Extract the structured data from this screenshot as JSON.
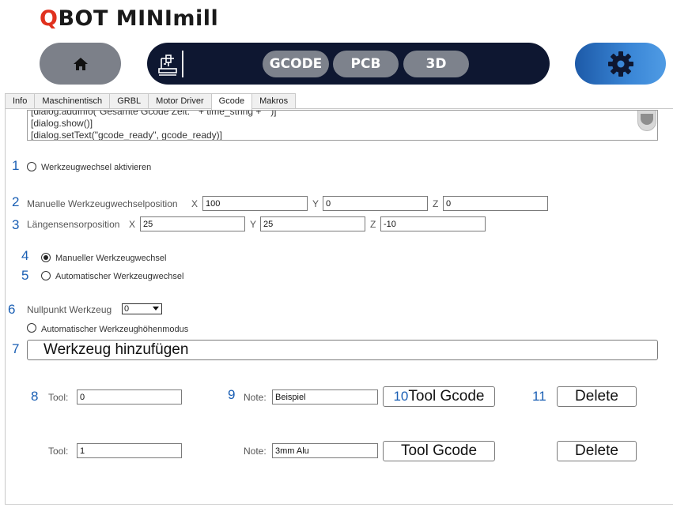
{
  "logo": {
    "q": "Q",
    "rest": "BOT MINImill"
  },
  "nav": {
    "home_icon": "home-icon",
    "machine_icon": "machine-icon",
    "pills": [
      "GCODE",
      "PCB",
      "3D"
    ],
    "settings_icon": "gear-icon"
  },
  "tabs": [
    "Info",
    "Maschinentisch",
    "GRBL",
    "Motor Driver",
    "Gcode",
    "Makros"
  ],
  "active_tab": "Gcode",
  "code": {
    "lines": [
      "[dialog.addInfo(\"Gesamte Gcode Zeit: \" + time_string + \"\")]",
      "[dialog.show()]",
      "[dialog.setText(\"gcode_ready\", gcode_ready)]"
    ]
  },
  "annotations": [
    "1",
    "2",
    "3",
    "4",
    "5",
    "6",
    "7",
    "8",
    "9",
    "10",
    "11"
  ],
  "toolchange": {
    "enable_label": "Werkzeugwechsel aktivieren",
    "manual_pos_label": "Manuelle Werkzeugwechselposition",
    "manual_pos": {
      "x": "100",
      "y": "0",
      "z": "0"
    },
    "sensor_pos_label": "Längensensorposition",
    "sensor_pos": {
      "x": "25",
      "y": "25",
      "z": "-10"
    },
    "axis_x": "X",
    "axis_y": "Y",
    "axis_z": "Z",
    "manual_label": "Manueller Werkzeugwechsel",
    "auto_label": "Automatischer Werkzeugwechsel",
    "zero_tool_label": "Nullpunkt Werkzeug",
    "zero_tool_value": "0",
    "auto_height_label": "Automatischer Werkzeughöhenmodus",
    "add_tool_label": "Werkzeug hinzufügen"
  },
  "tools": [
    {
      "tool_label": "Tool:",
      "tool": "0",
      "note_label": "Note:",
      "note": "Beispiel",
      "gcode_label": "Tool Gcode",
      "delete_label": "Delete"
    },
    {
      "tool_label": "Tool:",
      "tool": "1",
      "note_label": "Note:",
      "note": "3mm Alu",
      "gcode_label": "Tool Gcode",
      "delete_label": "Delete"
    }
  ],
  "colors": {
    "nav_dark": "#0e1731",
    "pill_gray": "#7d828c",
    "home_gray": "#7c8089",
    "settings_blue": "#2a6fc0",
    "annotation_blue": "#1a5fb4",
    "logo_red": "#e0311e"
  }
}
